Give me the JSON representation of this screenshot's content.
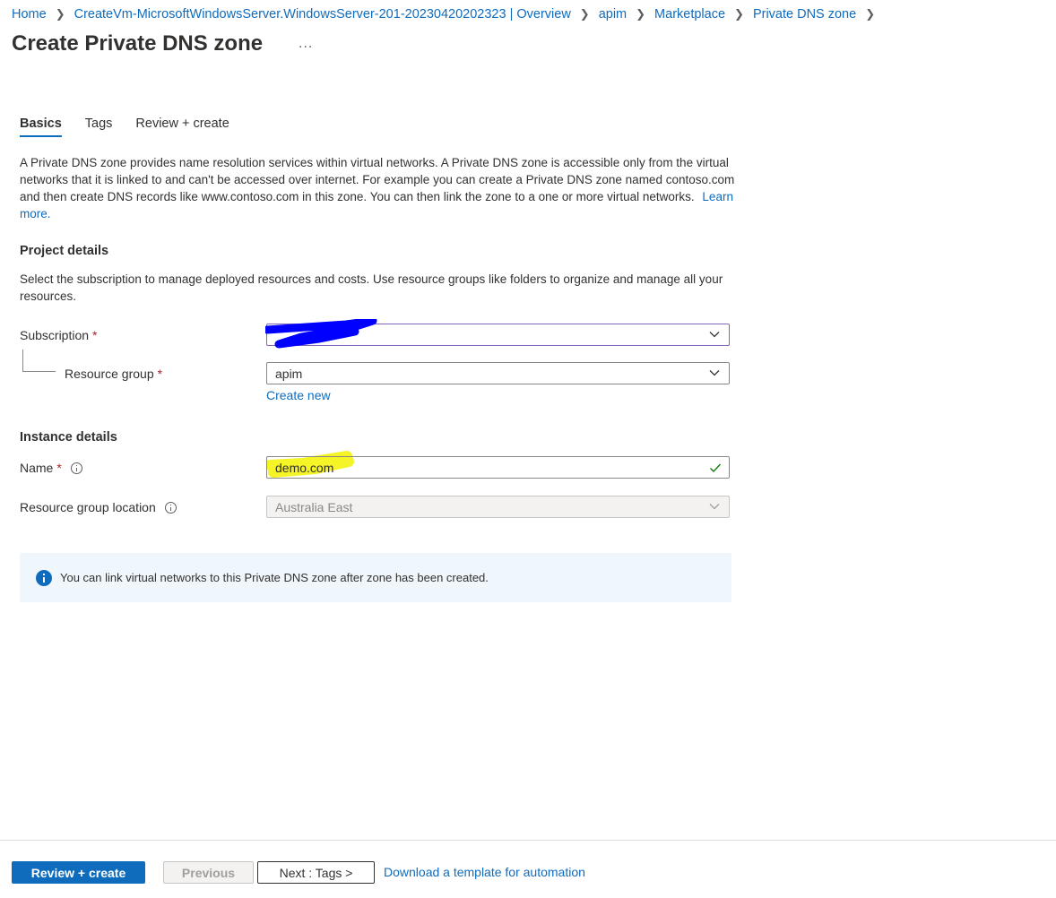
{
  "breadcrumb": [
    {
      "label": "Home"
    },
    {
      "label": "CreateVm-MicrosoftWindowsServer.WindowsServer-201-20230420202323 | Overview"
    },
    {
      "label": "apim"
    },
    {
      "label": "Marketplace"
    },
    {
      "label": "Private DNS zone"
    }
  ],
  "page": {
    "title": "Create Private DNS zone",
    "more": "..."
  },
  "tabs": [
    {
      "label": "Basics",
      "active": true
    },
    {
      "label": "Tags"
    },
    {
      "label": "Review + create"
    }
  ],
  "description": {
    "text": "A Private DNS zone provides name resolution services within virtual networks. A Private DNS zone is accessible only from the virtual networks that it is linked to and can't be accessed over internet. For example you can create a Private DNS zone named contoso.com and then create DNS records like www.contoso.com in this zone. You can then link the zone to a one or more virtual networks.",
    "learn_more": "Learn more."
  },
  "project_details": {
    "title": "Project details",
    "text": "Select the subscription to manage deployed resources and costs. Use resource groups like folders to organize and manage all your resources.",
    "subscription_label": "Subscription",
    "subscription_value": "",
    "resource_group_label": "Resource group",
    "resource_group_value": "apim",
    "create_new": "Create new",
    "required_mark": "*"
  },
  "instance_details": {
    "title": "Instance details",
    "name_label": "Name",
    "name_value": "demo.com",
    "location_label": "Resource group location",
    "location_value": "Australia East"
  },
  "info_banner": "You can link virtual networks to this Private DNS zone after zone has been created.",
  "footer": {
    "review_create": "Review + create",
    "previous": "Previous",
    "next": "Next : Tags >",
    "download": "Download a template for automation"
  },
  "colors": {
    "accent": "#0f6cbd",
    "redaction": "#0000ff",
    "highlight": "#f2f200",
    "valid": "#107c10"
  }
}
